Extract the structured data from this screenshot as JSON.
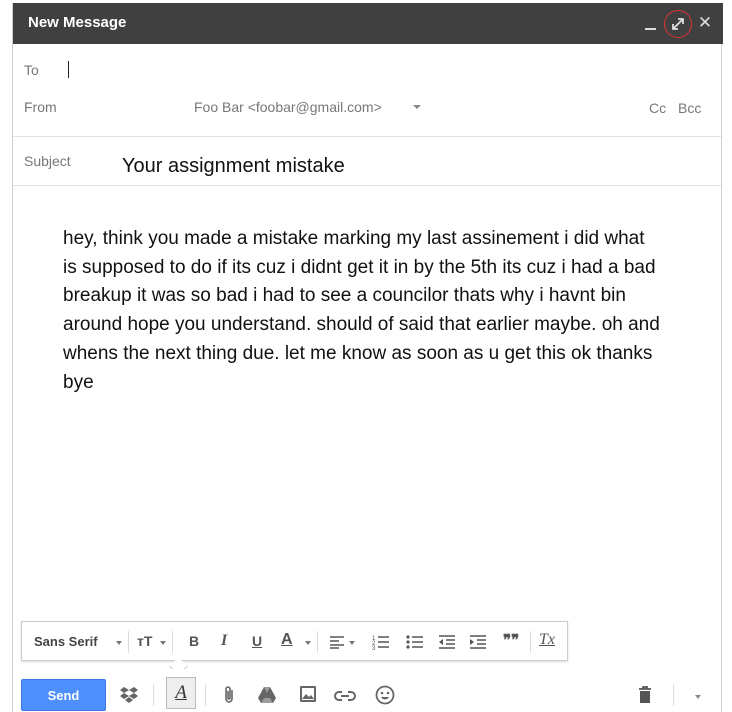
{
  "window": {
    "title": "New Message",
    "minimize_icon": "minimize-icon",
    "expand_icon": "expand-icon",
    "close_icon": "close-icon",
    "close_glyph": "✕"
  },
  "to": {
    "label": "To",
    "value": ""
  },
  "from": {
    "label": "From",
    "value": "Foo Bar <foobar@gmail.com>"
  },
  "recipients": {
    "cc": "Cc",
    "bcc": "Bcc"
  },
  "subject": {
    "label": "Subject",
    "value": "Your assignment mistake"
  },
  "body": {
    "text": "hey, think you made a mistake marking my last assinement i did what is supposed to do if its cuz i didnt get it in by the 5th its cuz i had a bad breakup it was so bad i had to see a councilor thats why i havnt bin around hope you understand. should of said that earlier maybe. oh and whens the next thing due. let me know as soon as u get this ok thanks bye"
  },
  "formatting": {
    "font": "Sans Serif",
    "size_glyph": "тT",
    "bold": "B",
    "italic": "I",
    "underline": "U",
    "text_color": "A",
    "quote": "❞❞",
    "clear": "Tx"
  },
  "bottom": {
    "send": "Send",
    "format_toggle": "A"
  },
  "colors": {
    "titlebar": "#404040",
    "send_button": "#4d90fe",
    "highlight_circle": "#dd3333"
  }
}
